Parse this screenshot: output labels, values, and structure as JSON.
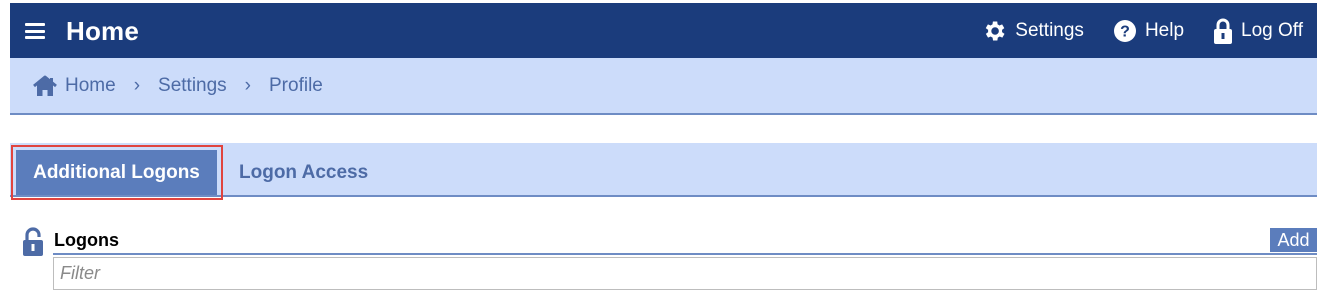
{
  "header": {
    "title": "Home",
    "menu_icon": "hamburger-menu-icon",
    "actions": [
      {
        "label": "Settings",
        "icon": "gear-icon"
      },
      {
        "label": "Help",
        "icon": "help-circle-icon"
      },
      {
        "label": "Log Off",
        "icon": "padlock-icon"
      }
    ]
  },
  "breadcrumb": {
    "items": [
      "Home",
      "Settings",
      "Profile"
    ],
    "home_icon": "house-icon",
    "separator": "›"
  },
  "tabs": [
    {
      "label": "Additional Logons",
      "active": true
    },
    {
      "label": "Logon Access",
      "active": false
    }
  ],
  "section": {
    "title": "Logons",
    "add_label": "Add",
    "filter_placeholder": "Filter",
    "filter_value": "",
    "icon": "open-lock-icon"
  },
  "colors": {
    "header_bg": "#1b3c7c",
    "subbar_bg": "#ccdcfa",
    "accent": "#5b7dbc",
    "link_text": "#4d6ba6",
    "highlight_outline": "#e0443e"
  }
}
